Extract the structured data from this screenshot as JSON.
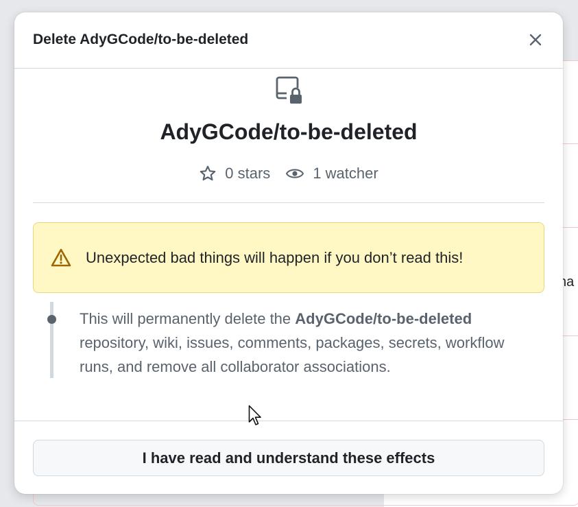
{
  "dialog": {
    "title": "Delete AdyGCode/to-be-deleted",
    "close_icon": "close-icon"
  },
  "repo": {
    "icon": "repo-locked-icon",
    "name": "AdyGCode/to-be-deleted",
    "stars_label": "0 stars",
    "watchers_label": "1 watcher"
  },
  "warning": {
    "icon": "alert-icon",
    "text": "Unexpected bad things will happen if you don’t read this!"
  },
  "effect": {
    "prefix": "This will permanently delete the ",
    "repo_name": "AdyGCode/to-be-deleted",
    "suffix": " repository, wiki, issues, comments, packages, secrets, workflow runs, and remove all collaborator associations."
  },
  "footer": {
    "confirm_label": "I have read and understand these effects"
  },
  "background": {
    "partial_text": "na"
  },
  "colors": {
    "warning_bg": "#fff8c5",
    "warning_icon": "#9a6700",
    "text_primary": "#1f2328",
    "text_muted": "#59636e"
  }
}
